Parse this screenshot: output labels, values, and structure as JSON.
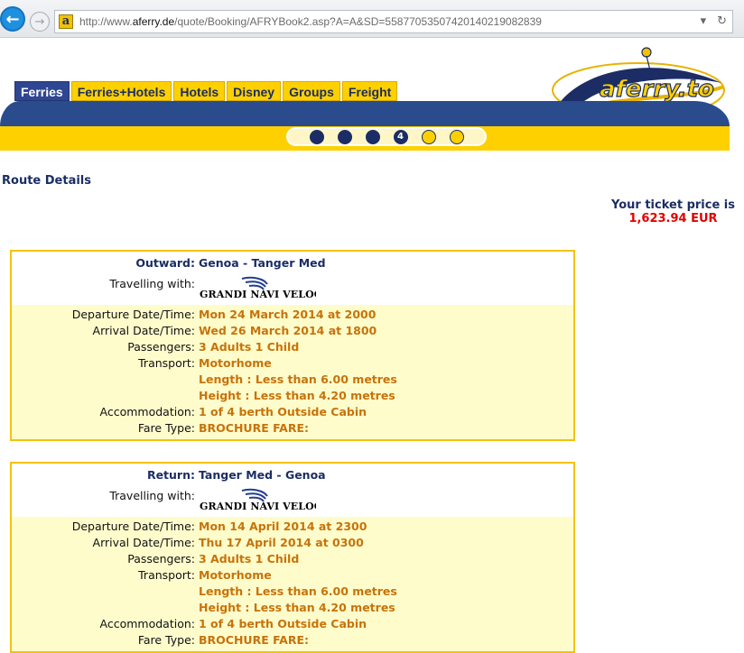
{
  "browser": {
    "url_prefix": "http://www.",
    "url_host": "aferry.de",
    "url_rest": "/quote/Booking/AFRYBook2.asp?A=A&SD=55877053507420140219082839"
  },
  "nav": {
    "tabs": [
      {
        "label": "Ferries",
        "active": true
      },
      {
        "label": "Ferries+Hotels",
        "active": false
      },
      {
        "label": "Hotels",
        "active": false
      },
      {
        "label": "Disney",
        "active": false
      },
      {
        "label": "Groups",
        "active": false
      },
      {
        "label": "Freight",
        "active": false
      }
    ]
  },
  "progress": {
    "current_step": 4,
    "total_steps": 6
  },
  "logo": {
    "text": "aferry.to"
  },
  "route_details_title": "Route Details",
  "price": {
    "label": "Your ticket price is",
    "value": "1,623.94 EUR"
  },
  "legs": [
    {
      "direction_label": "Outward:",
      "route": "Genoa - Tanger Med",
      "travelling_with_label": "Travelling with:",
      "operator": "GRANDI NAVI VELOCI",
      "departure_label": "Departure Date/Time:",
      "departure": "Mon 24 March 2014 at 2000",
      "arrival_label": "Arrival Date/Time:",
      "arrival": "Wed 26 March 2014 at 1800",
      "passengers_label": "Passengers:",
      "passengers": "3 Adults 1 Child",
      "transport_label": "Transport:",
      "transport": "Motorhome",
      "length": "Length : Less than 6.00 metres",
      "height": "Height : Less than 4.20 metres",
      "accommodation_label": "Accommodation:",
      "accommodation": "1 of 4 berth Outside Cabin",
      "fare_label": "Fare Type:",
      "fare": "BROCHURE FARE:"
    },
    {
      "direction_label": "Return:",
      "route": "Tanger Med - Genoa",
      "travelling_with_label": "Travelling with:",
      "operator": "GRANDI NAVI VELOCI",
      "departure_label": "Departure Date/Time:",
      "departure": "Mon 14 April 2014 at 2300",
      "arrival_label": "Arrival Date/Time:",
      "arrival": "Thu 17 April 2014 at 0300",
      "passengers_label": "Passengers:",
      "passengers": "3 Adults 1 Child",
      "transport_label": "Transport:",
      "transport": "Motorhome",
      "length": "Length : Less than 6.00 metres",
      "height": "Height : Less than 4.20 metres",
      "accommodation_label": "Accommodation:",
      "accommodation": "1 of 4 berth Outside Cabin",
      "fare_label": "Fare Type:",
      "fare": "BROCHURE FARE:"
    }
  ],
  "colors": {
    "brand_navy": "#1b2d64",
    "brand_yellow": "#ffd000",
    "value_orange": "#c7730a",
    "price_red": "#e00000"
  }
}
